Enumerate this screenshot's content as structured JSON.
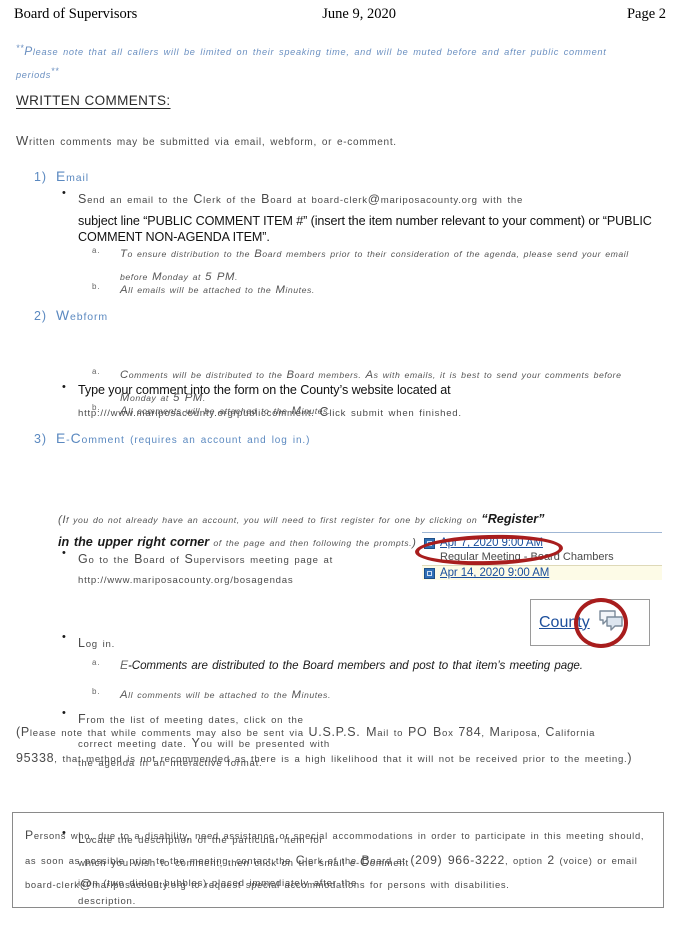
{
  "header": {
    "left": "Board of Supervisors",
    "center": "June 9, 2020",
    "right": "Page 2"
  },
  "top_note": {
    "open_marker": "**",
    "text": "Please note that all callers will be limited on their speaking time, and will be muted before and after public comment periods",
    "close_marker": "**",
    "color": "#6a8fc0"
  },
  "section": {
    "heading": "WRITTEN COMMENTS:",
    "intro": "Written comments may be submitted via email, webform, or e-comment."
  },
  "items": [
    {
      "number": "1)",
      "title": "Email",
      "bullets": [
        {
          "light_lead": "Send an email to the Clerk of the Board at board-clerk@mariposacounty.org with the",
          "dark_rest": "subject line “PUBLIC COMMENT ITEM #” (insert the item number relevant to your comment) or “PUBLIC COMMENT NON-AGENDA ITEM”."
        }
      ],
      "subs": [
        {
          "label": "a.",
          "text": "To ensure distribution to the Board members prior to their consideration of the agenda, please send your email before Monday at 5 PM."
        },
        {
          "label": "b.",
          "text": "All emails will be attached to the Minutes."
        }
      ]
    },
    {
      "number": "2)",
      "title": "Webform",
      "bullets": [
        {
          "dark_lead": "Type your comment into the form on the County’s website located at",
          "light_rest": "http:///www.mariposacounty.org/publiccomment. Click submit when finished."
        }
      ],
      "subs": [
        {
          "label": "a.",
          "text": "Comments will be distributed to the Board members. As with emails, it is best to send your comments before Monday at 5 PM."
        },
        {
          "label": "b.",
          "text": "All comments will be attached to the Minutes."
        }
      ]
    },
    {
      "number": "3)",
      "title": "E-Comment",
      "title_suffix": "(requires an account and log in.)",
      "bullets": [
        {
          "line1": "Go to the Board of Supervisors meeting page at",
          "line2": "http://www.mariposacounty.org/bosagendas"
        },
        {
          "line1": "Log in.",
          "paren_lead": "(If you do not already have an account, you will need to first register for one by clicking on",
          "paren_bold": "“Register” in the upper right corner",
          "paren_tail": "of the page and then following the prompts.)"
        },
        {
          "line1": "From the list of meeting dates, click on the",
          "line2": "correct meeting date. You will be presented with",
          "line3": "the agenda in an interactive format."
        },
        {
          "line1": "Locate the description of the particular item for",
          "line2": "which you wish to comment, then click on the small e-Comment",
          "line3": "icon (two dialog bubbles) placed immediately after the",
          "line4": "description."
        }
      ],
      "subs": [
        {
          "label": "a.",
          "text": "E-Comments are distributed to the Board members and post to that item’s meeting page."
        },
        {
          "label": "b.",
          "text": "All comments will be attached to the Minutes."
        }
      ]
    }
  ],
  "inset_meetings": {
    "rows": [
      {
        "link": "Apr 7, 2020 9:00 AM",
        "sub": "Regular Meeting - Board Chambers"
      },
      {
        "link": "Apr 14, 2020 9:00 AM"
      }
    ],
    "link_color": "#1a4f9c",
    "highlight_color": "#fdfbe7"
  },
  "inset_ecomment": {
    "link_text": "County",
    "icon": "two-dialog-bubbles"
  },
  "annotations": {
    "color": "#a81d1d",
    "circle_meeting_date": "Apr 7, 2020 9:00 AM",
    "circle_ecomment_icon": "e-comment bubbles icon"
  },
  "closing_note": "(Please note that while comments may also be sent via U.S.P.S. Mail to PO Box 784, Mariposa, California 95338, that method is not recommended as there is a high likelihood that it will not be received prior to the meeting.)",
  "ada_notice": "Persons who, due to a disability, need assistance or special accommodations in order to participate in this meeting should, as soon as possible prior to the meeting, contact the Clerk of the Board at (209) 966-3222, option 2 (voice) or email board-clerk@mariposacounty.org to request special accommodations for persons with disabilities."
}
